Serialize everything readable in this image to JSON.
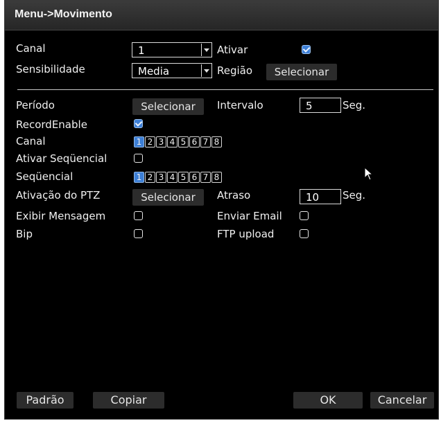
{
  "window": {
    "title": "Menu->Movimento"
  },
  "canal": {
    "label": "Canal",
    "value": "1"
  },
  "ativar": {
    "label": "Ativar",
    "checked": true
  },
  "sensibilidade": {
    "label": "Sensibilidade",
    "value": "Media"
  },
  "regiao": {
    "label": "Região",
    "button": "Selecionar"
  },
  "periodo": {
    "label": "Período",
    "button": "Selecionar"
  },
  "intervalo": {
    "label": "Intervalo",
    "value": "5",
    "unit": "Seg."
  },
  "record_enable": {
    "label": "RecordEnable",
    "checked": true
  },
  "canal_channels": {
    "label": "Canal",
    "items": [
      "1",
      "2",
      "3",
      "4",
      "5",
      "6",
      "7",
      "8"
    ],
    "selected": [
      "1"
    ]
  },
  "ativar_sequencial": {
    "label": "Ativar Seqüencial",
    "checked": false
  },
  "sequencial": {
    "label": "Seqüencial",
    "items": [
      "1",
      "2",
      "3",
      "4",
      "5",
      "6",
      "7",
      "8"
    ],
    "selected": [
      "1"
    ]
  },
  "ptz": {
    "label": "Ativação do PTZ",
    "button": "Selecionar"
  },
  "atraso": {
    "label": "Atraso",
    "value": "10",
    "unit": "Seg."
  },
  "exibir_mensagem": {
    "label": "Exibir Mensagem",
    "checked": false
  },
  "enviar_email": {
    "label": "Enviar Email",
    "checked": false
  },
  "bip": {
    "label": "Bip",
    "checked": false
  },
  "ftp_upload": {
    "label": "FTP upload",
    "checked": false
  },
  "footer": {
    "padrao": "Padrão",
    "copiar": "Copiar",
    "ok": "OK",
    "cancelar": "Cancelar"
  },
  "colors": {
    "accent": "#3d7fd6",
    "background": "#000000",
    "titlebar": "#2f2f2f"
  }
}
